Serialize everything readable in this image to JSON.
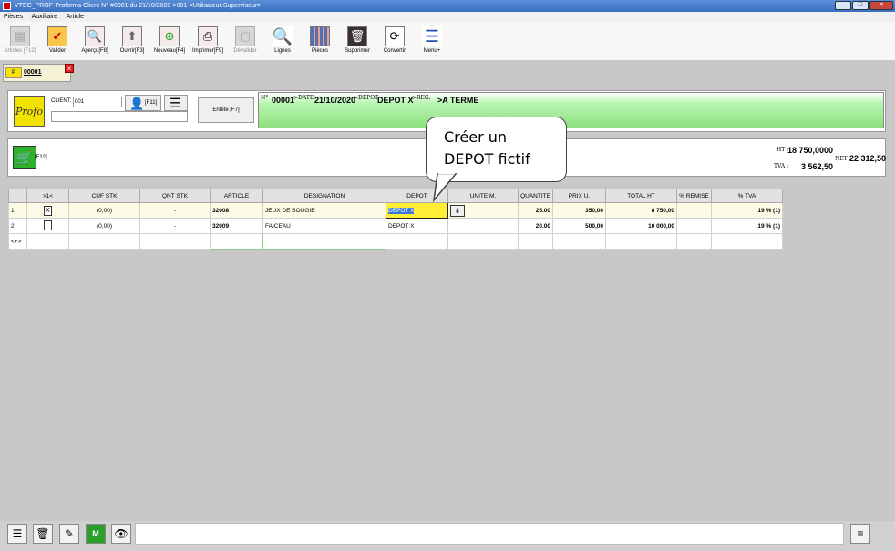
{
  "window": {
    "title": "VTEC_PROF-Proforma Client-N° #0001 du 21/10/2020->001-<Utilisateur:Superviseur>"
  },
  "menu": [
    "Pièces",
    "Auxiliaire",
    "Article"
  ],
  "toolbar": [
    {
      "label": "Articles [F12]",
      "icon": "articles-icon",
      "disabled": true
    },
    {
      "label": "Valider",
      "icon": "check-icon"
    },
    {
      "label": "Aperçu[F8]",
      "icon": "preview-icon"
    },
    {
      "label": "Ouvrir[F3]",
      "icon": "open-icon"
    },
    {
      "label": "Nouveau[F4]",
      "icon": "new-icon"
    },
    {
      "label": "Imprimer[F9]",
      "icon": "print-icon"
    },
    {
      "label": "Dévalider",
      "icon": "devalidate-icon",
      "disabled": true
    },
    {
      "label": "Lignes",
      "icon": "lines-icon"
    },
    {
      "label": "Pièces",
      "icon": "pieces-icon"
    },
    {
      "label": "Supprimer",
      "icon": "trash-icon"
    },
    {
      "label": "Convertir",
      "icon": "convert-icon"
    },
    {
      "label": "Menu+",
      "icon": "menu-icon"
    }
  ],
  "tab": {
    "label": "00001"
  },
  "header": {
    "client_label": "CLIENT:",
    "client_value": "001",
    "user_key": "[F11]",
    "entete_button": "Entête [F7]",
    "num_label": "N°",
    "num_value": "00001",
    "date_label": ">DATE",
    "date_value": "21/10/2020",
    "depot_label": ">DEPOT",
    "depot_value": "DEPOT X",
    "reg_label": ">REG.",
    "reg_value": ">A TERME"
  },
  "totals": {
    "cart_key": "[F12]",
    "ht_label": "HT :",
    "ht_value": "18 750,0000",
    "tva_label": "TVA :",
    "tva_value": "3 562,50",
    "net_label": "NET :",
    "net_value": "22 312,50"
  },
  "grid": {
    "columns": [
      ">1<",
      "CUF STK",
      "QNT STK",
      "ARTICLE",
      "DESIGNATION",
      "DEPOT",
      "UNITE M.",
      "QUANTITE",
      "PRIX U.",
      "TOTAL HT",
      "% REMISE",
      "% TVA"
    ],
    "rows": [
      {
        "num": "1",
        "check": "X",
        "cuf": "(0,00)",
        "qnt": "-",
        "article": "32008",
        "designation": "JEUX DE BOUGIE",
        "depot": "DEPOT X",
        "unite": "",
        "quantite": "25.00",
        "prix": "350,00",
        "total": "8 750,00",
        "remise": "",
        "tva": "19 % (1)"
      },
      {
        "num": "2",
        "check": "",
        "cuf": "(0,00)",
        "qnt": "-",
        "article": "32009",
        "designation": "FAICEAU",
        "depot": "DEPOT X",
        "unite": "",
        "quantite": "20.00",
        "prix": "500,00",
        "total": "10 000,00",
        "remise": "",
        "tva": "19 % (1)"
      }
    ],
    "new_row_marker": "<+>"
  },
  "callout": {
    "line1": "Créer un",
    "line2": "DEPOT fictif"
  }
}
